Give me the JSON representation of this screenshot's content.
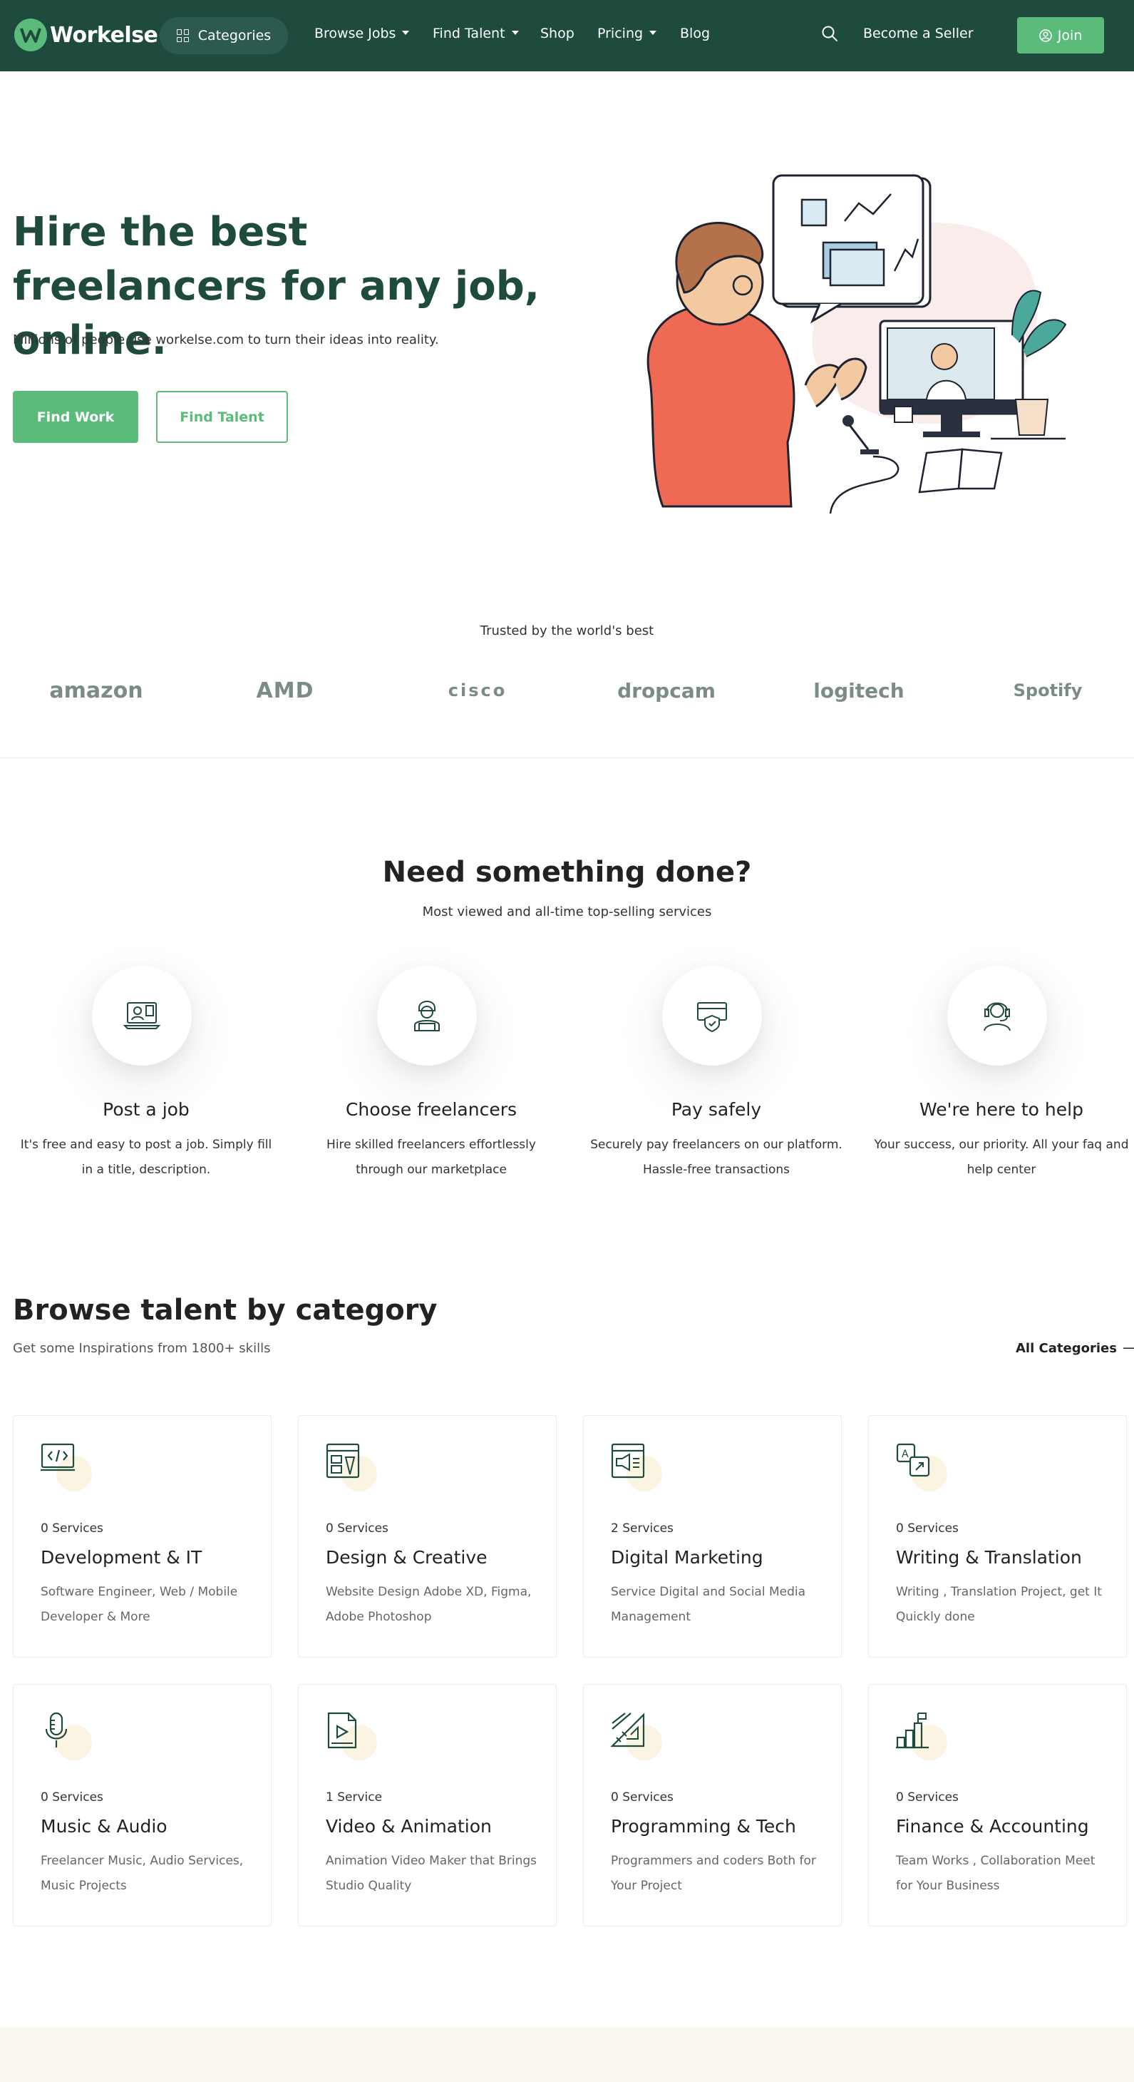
{
  "nav": {
    "logo_text": "Workelse",
    "categories_label": "Categories",
    "items": [
      {
        "label": "Browse Jobs",
        "dropdown": true
      },
      {
        "label": "Find Talent",
        "dropdown": true
      },
      {
        "label": "Shop",
        "dropdown": false
      },
      {
        "label": "Pricing",
        "dropdown": true
      },
      {
        "label": "Blog",
        "dropdown": false
      }
    ],
    "become_seller": "Become a Seller",
    "join": "Join"
  },
  "hero": {
    "title": "Hire the best freelancers for any job, online.",
    "subtitle": "Millions of people use workelse.com to turn their ideas into reality.",
    "find_work": "Find Work",
    "find_talent": "Find Talent"
  },
  "trusted": {
    "label": "Trusted by the world's best",
    "brands": [
      "amazon",
      "AMD",
      "cisco",
      "dropcam",
      "logitech",
      "Spotify"
    ]
  },
  "need": {
    "title": "Need something done?",
    "subtitle": "Most viewed and all-time top-selling services",
    "steps": [
      {
        "title": "Post a job",
        "desc": "It's free and easy to post a job. Simply fill in a title, description.",
        "icon": "post-job-icon"
      },
      {
        "title": "Choose freelancers",
        "desc": "Hire skilled freelancers effortlessly through our marketplace",
        "icon": "freelancer-icon"
      },
      {
        "title": "Pay safely",
        "desc": "Securely pay freelancers on our platform. Hassle-free transactions",
        "icon": "secure-payment-icon"
      },
      {
        "title": "We're here to help",
        "desc": "Your success, our priority. All your faq and help center",
        "icon": "support-headset-icon"
      }
    ]
  },
  "browse": {
    "title": "Browse talent by category",
    "subtitle": "Get some Inspirations from 1800+ skills",
    "all_link": "All Categories",
    "categories": [
      {
        "count": "0 Services",
        "title": "Development & IT",
        "desc": "Software Engineer, Web / Mobile Developer & More",
        "icon": "code-laptop-icon"
      },
      {
        "count": "0 Services",
        "title": "Design & Creative",
        "desc": "Website Design Adobe XD, Figma, Adobe Photoshop",
        "icon": "design-browser-icon"
      },
      {
        "count": "2 Services",
        "title": "Digital Marketing",
        "desc": "Service Digital and Social Media Management",
        "icon": "megaphone-icon"
      },
      {
        "count": "0 Services",
        "title": "Writing & Translation",
        "desc": "Writing , Translation Project, get It Quickly done",
        "icon": "translation-icon"
      },
      {
        "count": "0 Services",
        "title": "Music & Audio",
        "desc": "Freelancer Music, Audio Services, Music Projects",
        "icon": "microphone-icon"
      },
      {
        "count": "1 Service",
        "title": "Video & Animation",
        "desc": "Animation Video Maker that Brings Studio Quality",
        "icon": "video-file-icon"
      },
      {
        "count": "0 Services",
        "title": "Programming & Tech",
        "desc": "Programmers and coders Both for Your Project",
        "icon": "ruler-triangle-icon"
      },
      {
        "count": "0 Services",
        "title": "Finance & Accounting",
        "desc": "Team Works , Collaboration Meet for Your Business",
        "icon": "bar-chart-flag-icon"
      }
    ]
  },
  "colors": {
    "brand_dark": "#1f4b3f",
    "brand_green": "#5bbb7b",
    "accent_cream": "#fbf4e3"
  }
}
